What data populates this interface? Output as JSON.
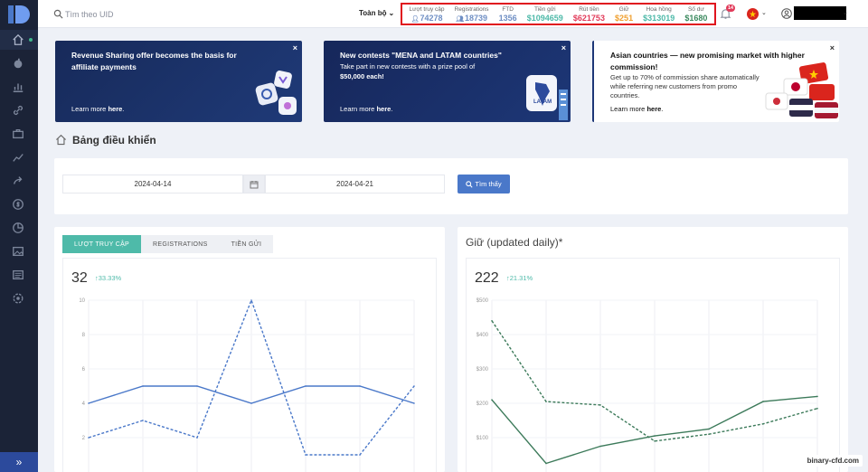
{
  "header": {
    "search_placeholder": "Tìm theo UID",
    "scope_label": "Toàn bộ",
    "notification_count": "14",
    "stats": [
      {
        "label": "Lượt truy cập",
        "value": "74278",
        "color": "#6f8fc4",
        "icon": "person-icon"
      },
      {
        "label": "Registrations",
        "value": "18739",
        "color": "#6f8fc4",
        "icon": "people-icon"
      },
      {
        "label": "FTD",
        "value": "1356",
        "color": "#6f8fc4",
        "icon": ""
      },
      {
        "label": "Tiền gửi",
        "value": "$1094659",
        "color": "#4ebaa9",
        "icon": ""
      },
      {
        "label": "Rút tiền",
        "value": "$621753",
        "color": "#e23b5a",
        "icon": ""
      },
      {
        "label": "Giữ",
        "value": "$251",
        "color": "#f0a030",
        "icon": ""
      },
      {
        "label": "Hoa hồng",
        "value": "$313019",
        "color": "#4ebaa9",
        "icon": ""
      },
      {
        "label": "Số dư",
        "value": "$1680",
        "color": "#3c8a5f",
        "icon": ""
      }
    ]
  },
  "banners": [
    {
      "title": "Revenue Sharing offer becomes the basis for affiliate payments",
      "subtitle": "",
      "learn_prefix": "Learn more ",
      "learn_link": "here",
      "learn_suffix": "."
    },
    {
      "title": "New contests \"MENA and LATAM countries\"",
      "subtitle_1": "Take part in new contests with a prize pool of",
      "subtitle_2": "$50,000 each!",
      "learn_prefix": "Learn more ",
      "learn_link": "here",
      "learn_suffix": ".",
      "map_label": "LATAM"
    },
    {
      "title": "Asian countries — new promising market with higher commission!",
      "subtitle": "Get up to 70% of commission share automatically while referring new customers from promo countries.",
      "learn_prefix": "Learn more ",
      "learn_link": "here",
      "learn_suffix": "."
    }
  ],
  "page": {
    "title": "Bảng điều khiển"
  },
  "filter": {
    "date_from": "2024-04-14",
    "date_to": "2024-04-21",
    "find_label": "Tìm thấy"
  },
  "left_card": {
    "tabs": [
      "LƯỢT TRUY CẬP",
      "REGISTRATIONS",
      "TIỀN GỬI"
    ],
    "active_tab": 0,
    "total": "32",
    "change": "33.33%"
  },
  "right_card": {
    "title": "Giữ (updated daily)*",
    "total": "222",
    "change": "21.31%"
  },
  "watermark": "binary-cfd.com",
  "chart_data": [
    {
      "type": "line",
      "x": [
        1,
        2,
        3,
        4,
        5,
        6,
        7
      ],
      "y_ticks": [
        "10",
        "8",
        "6",
        "4",
        "2"
      ],
      "ylim": [
        0,
        10
      ],
      "series": [
        {
          "style": "solid",
          "color": "#4a78c9",
          "values": [
            4,
            5,
            5,
            4,
            5,
            5,
            4
          ]
        },
        {
          "style": "dashed",
          "color": "#4a78c9",
          "values": [
            2,
            3,
            2,
            10,
            1,
            1,
            5
          ]
        }
      ]
    },
    {
      "type": "line",
      "x": [
        1,
        2,
        3,
        4,
        5,
        6,
        7
      ],
      "y_ticks": [
        "$500",
        "$400",
        "$300",
        "$200",
        "$100"
      ],
      "ylim": [
        0,
        500
      ],
      "series": [
        {
          "style": "solid",
          "color": "#3c7a5a",
          "values": [
            210,
            25,
            75,
            105,
            125,
            205,
            220
          ]
        },
        {
          "style": "dashed",
          "color": "#3c7a5a",
          "values": [
            440,
            205,
            195,
            90,
            110,
            140,
            185
          ]
        }
      ]
    }
  ]
}
